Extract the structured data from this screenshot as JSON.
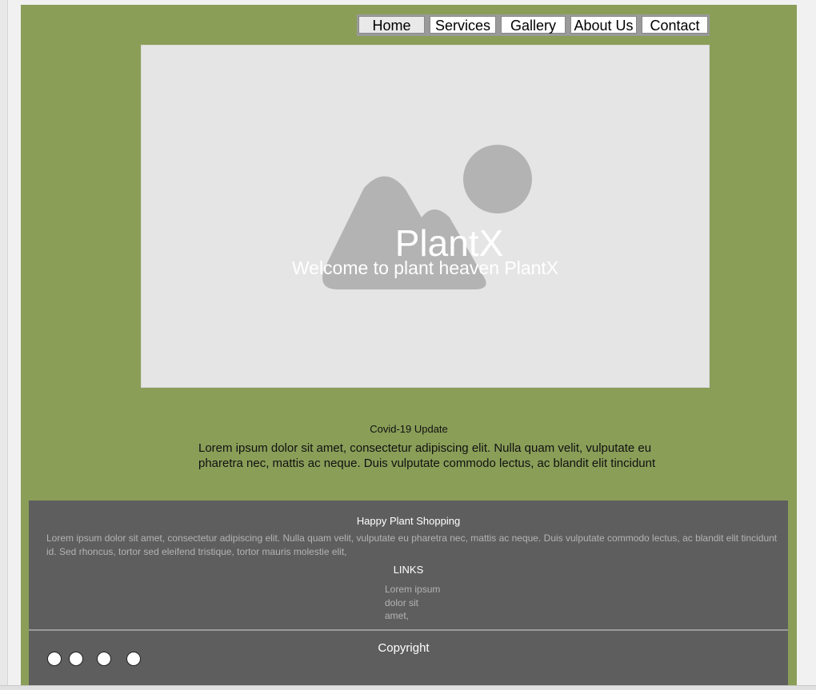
{
  "nav": {
    "items": [
      {
        "label": "Home",
        "active": true
      },
      {
        "label": "Services",
        "active": false
      },
      {
        "label": "Gallery",
        "active": false
      },
      {
        "label": "About Us",
        "active": false
      },
      {
        "label": "Contact",
        "active": false
      }
    ]
  },
  "hero": {
    "image_icon": "image-placeholder-icon",
    "title": "PlantX",
    "subtitle": "Welcome to plant heaven PlantX"
  },
  "covid": {
    "title": "Covid-19 Update",
    "text": "Lorem ipsum dolor sit amet, consectetur adipiscing elit. Nulla quam velit, vulputate eu pharetra nec, mattis ac neque. Duis vulputate commodo lectus, ac blandit elit tincidunt"
  },
  "footer": {
    "title": "Happy Plant Shopping",
    "text": "Lorem ipsum dolor sit amet, consectetur adipiscing elit. Nulla quam velit, vulputate eu pharetra nec, mattis ac neque. Duis vulputate commodo lectus, ac blandit elit tincidunt id. Sed rhoncus, tortor sed eleifend tristique, tortor mauris molestie elit,",
    "links_title": "LINKS",
    "links": [
      "Lorem ipsum",
      "dolor sit",
      "amet,"
    ],
    "copyright": "Copyright",
    "social_icons": [
      "social-icon",
      "social-icon",
      "social-icon",
      "social-icon"
    ]
  },
  "colors": {
    "page_bg": "#8a9e58",
    "footer_bg": "#5e5e5e",
    "hero_bg": "#e5e5e5",
    "placeholder_shape": "#b3b3b3"
  }
}
